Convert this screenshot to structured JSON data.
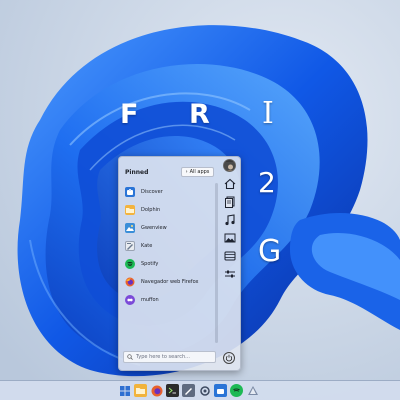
{
  "desktop": {
    "letters": [
      "F",
      "R",
      "I",
      "2",
      "G"
    ]
  },
  "launcher": {
    "pinned_label": "Pinned",
    "all_apps_label": "All apps",
    "apps": [
      {
        "label": "Discover",
        "icon": "discover-icon",
        "color": "#2a74d6"
      },
      {
        "label": "Dolphin",
        "icon": "dolphin-folder-icon",
        "color": "#f3b33d"
      },
      {
        "label": "Gwenview",
        "icon": "gwenview-icon",
        "color": "#3a8ed8"
      },
      {
        "label": "Kate",
        "icon": "kate-icon",
        "color": "#6b7a8f"
      },
      {
        "label": "Spotify",
        "icon": "spotify-icon",
        "color": "#1db954"
      },
      {
        "label": "Navegador web Firefox",
        "icon": "firefox-icon",
        "color": "#e8612c"
      },
      {
        "label": "muffon",
        "icon": "muffon-icon",
        "color": "#7b4ad8"
      }
    ],
    "search_placeholder": "Type here to search...",
    "rail": [
      "home-icon",
      "documents-icon",
      "music-icon",
      "pictures-icon",
      "videos-icon",
      "settings-sliders-icon"
    ]
  },
  "taskbar": {
    "icons": [
      {
        "name": "start-icon",
        "color": "#2e6fd1"
      },
      {
        "name": "files-icon",
        "color": "#f1b33c"
      },
      {
        "name": "firefox-icon",
        "color": "#e8612c"
      },
      {
        "name": "terminal-icon",
        "color": "#2b2b2b"
      },
      {
        "name": "kate-icon",
        "color": "#5f6b80"
      },
      {
        "name": "settings-icon",
        "color": "#3d4a61"
      },
      {
        "name": "discover-icon",
        "color": "#2a74d6"
      },
      {
        "name": "spotify-icon",
        "color": "#1db954"
      },
      {
        "name": "muffon-icon",
        "color": "#7b4ad8"
      }
    ]
  }
}
